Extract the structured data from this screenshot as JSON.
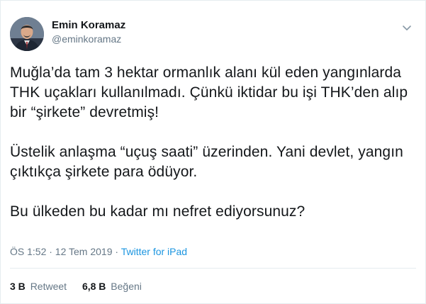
{
  "author": {
    "display_name": "Emin Koramaz",
    "handle": "@eminkoramaz"
  },
  "tweet": {
    "paragraphs": [
      "Muğla’da tam 3 hektar ormanlık alanı kül eden yangınlarda THK uçakları kullanılmadı. Çünkü iktidar bu işi THK’den alıp bir “şirkete” devretmiş!",
      "Üstelik anlaşma “uçuş saati” üzerinden. Yani devlet, yangın çıktıkça şirkete para ödüyor.",
      "Bu ülkeden bu kadar mı nefret ediyorsunuz?"
    ]
  },
  "meta": {
    "time": "ÖS 1:52 · 12 Tem 2019",
    "separator": " · ",
    "source": "Twitter for iPad"
  },
  "stats": {
    "retweets_count": "3 B",
    "retweets_label": "Retweet",
    "likes_count": "6,8 B",
    "likes_label": "Beğeni"
  },
  "icons": {
    "avatar": "profile-photo",
    "caret": "chevron-down-icon"
  },
  "colors": {
    "text": "#14171a",
    "secondary": "#657786",
    "link": "#1b95e0",
    "border": "#e6ecf0"
  }
}
